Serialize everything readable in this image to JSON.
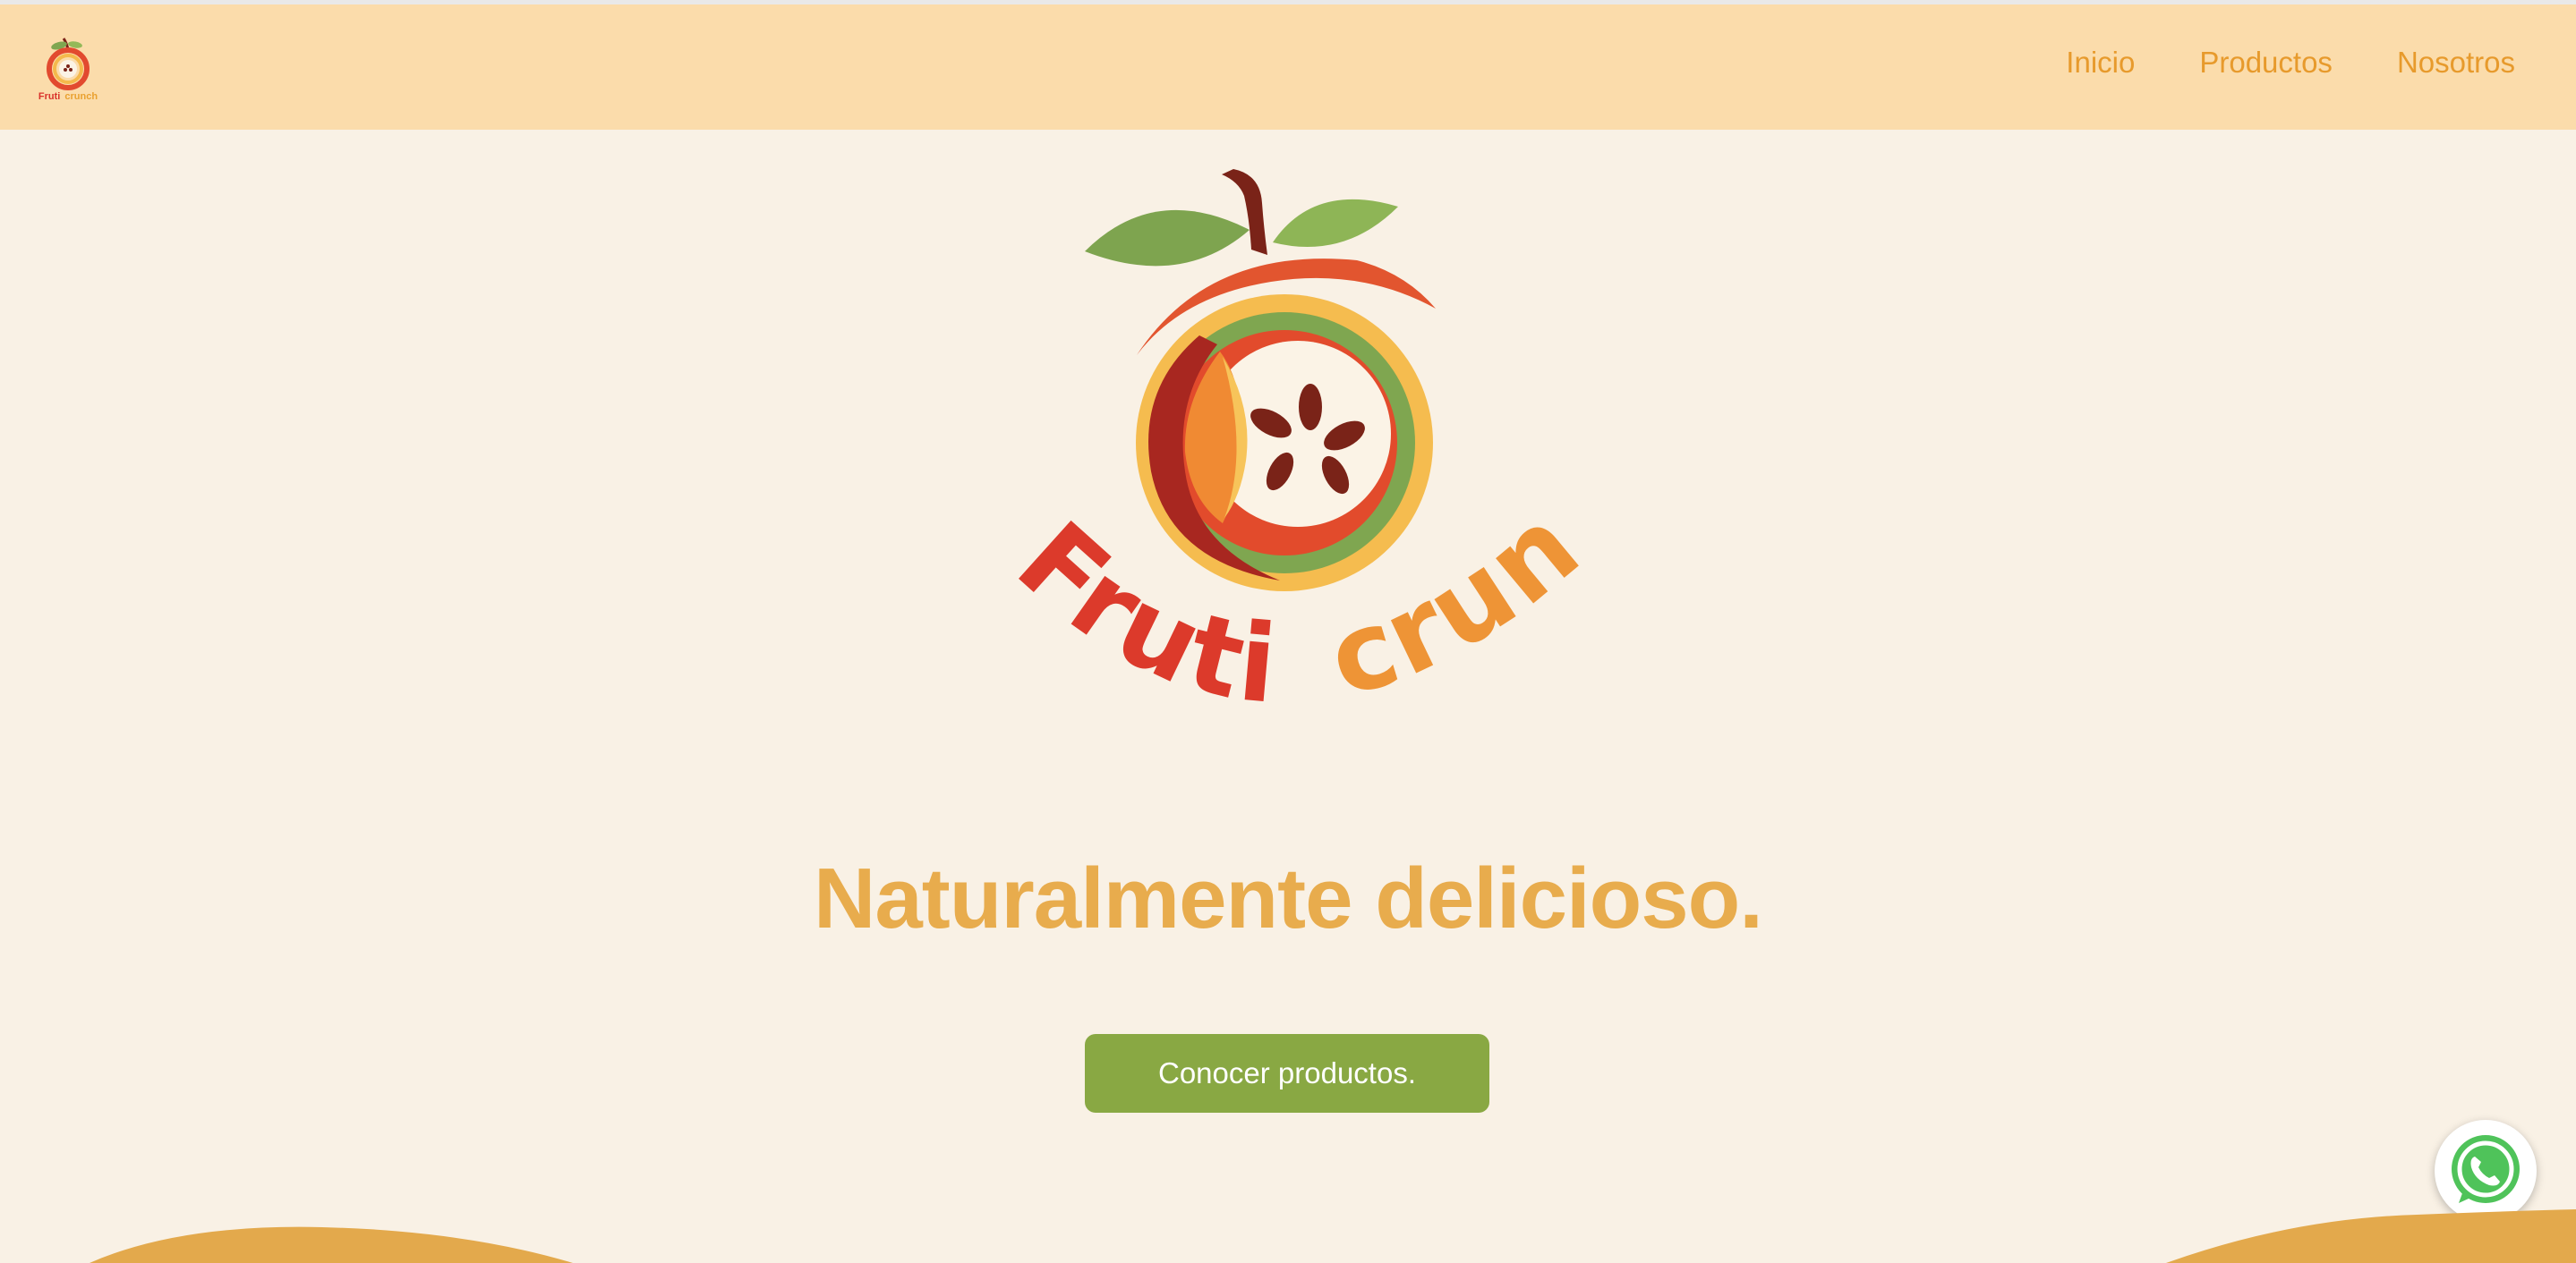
{
  "brand": {
    "name_part1": "Fruti",
    "name_part2": "crunch",
    "nav_logo_text": "Fruti crunch"
  },
  "nav": {
    "items": [
      {
        "label": "Inicio"
      },
      {
        "label": "Productos"
      },
      {
        "label": "Nosotros"
      }
    ]
  },
  "hero": {
    "tagline": "Naturalmente delicioso.",
    "cta_label": "Conocer productos."
  },
  "colors": {
    "navbar_bg": "#fbdcab",
    "page_bg": "#f9f1e5",
    "nav_link": "#e79a2c",
    "tagline": "#e8ac4d",
    "cta_bg": "#89a843",
    "wave": "#e3a94c",
    "whatsapp": "#4fc35a"
  },
  "icons": {
    "nav_logo": "fruti-crunch-logo-small",
    "hero_logo": "fruti-crunch-logo",
    "chat": "whatsapp-icon"
  }
}
